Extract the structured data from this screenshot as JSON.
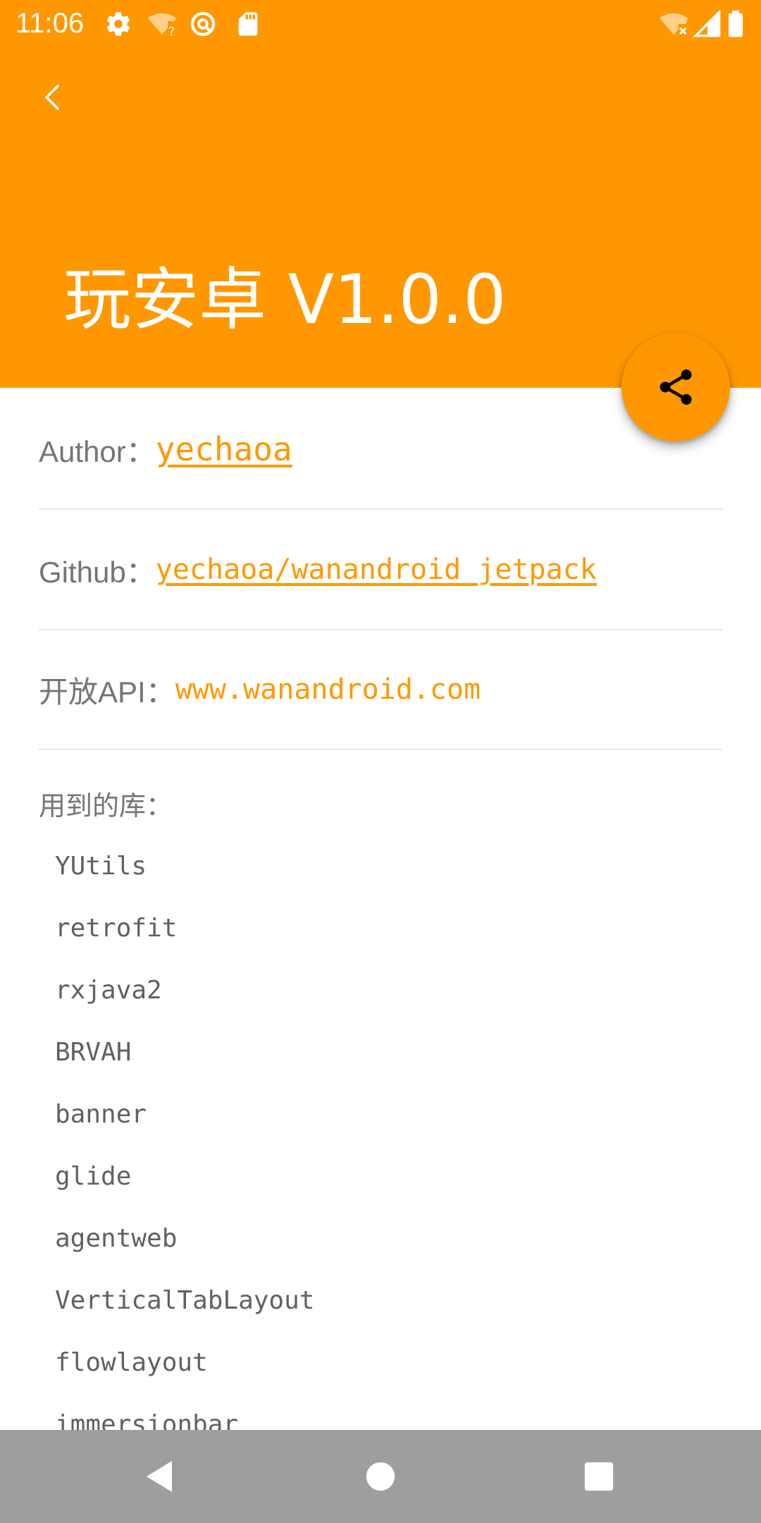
{
  "status_bar": {
    "time": "11:06",
    "icons_left": [
      "gear-icon",
      "wifi-question-icon",
      "sync-icon",
      "sd-card-icon"
    ],
    "icons_right": [
      "wifi-off-icon",
      "signal-icon",
      "battery-icon"
    ]
  },
  "header": {
    "title": "玩安卓  V1.0.0",
    "background_color": "#FF9800",
    "back_icon": "chevron-left-icon"
  },
  "fab": {
    "icon": "share-icon",
    "color": "#FF9800"
  },
  "info": {
    "author_label": "Author：",
    "author_value": "yechaoa",
    "github_label": "Github：",
    "github_value": "yechaoa/wanandroid_jetpack",
    "api_label": "开放API：",
    "api_value": "www.wanandroid.com"
  },
  "libraries": {
    "title": "用到的库：",
    "items": [
      "YUtils",
      "retrofit",
      "rxjava2",
      "BRVAH",
      "banner",
      "glide",
      "agentweb",
      "VerticalTabLayout",
      "flowlayout",
      "immersionbar"
    ]
  },
  "nav_bar": {
    "buttons": [
      "back-triangle-icon",
      "home-circle-icon",
      "recents-square-icon"
    ]
  },
  "colors": {
    "accent": "#FF9800",
    "text_secondary": "#757575",
    "divider": "#E6E6E6",
    "nav_bar": "#9E9E9E"
  }
}
